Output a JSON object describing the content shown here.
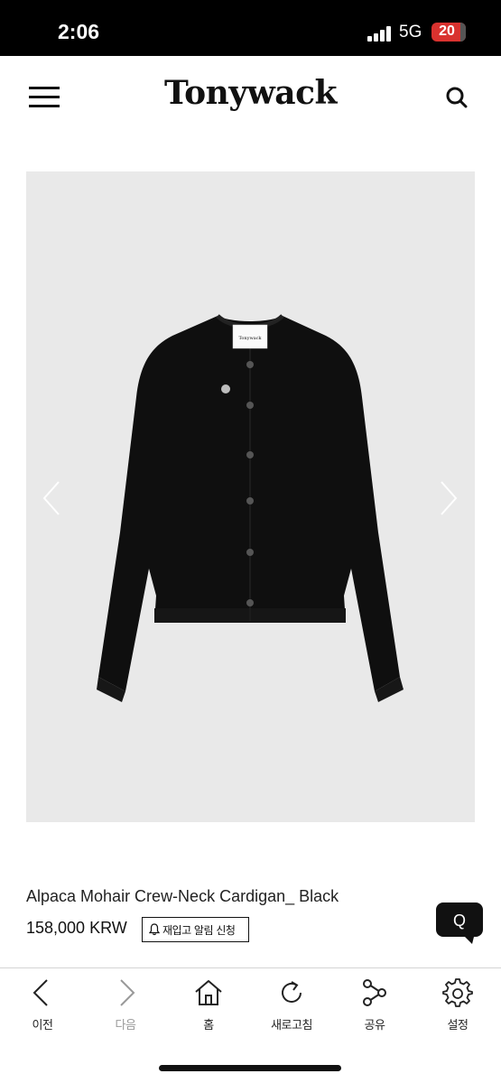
{
  "status_bar": {
    "time": "2:06",
    "network": "5G",
    "battery": "20"
  },
  "header": {
    "brand": "Tonywack",
    "menu_icon": "hamburger-menu-icon",
    "search_icon": "search-icon"
  },
  "gallery": {
    "prev_icon": "chevron-left-icon",
    "next_icon": "chevron-right-icon",
    "label_text": "Tonywack"
  },
  "product": {
    "name": "Alpaca Mohair Crew-Neck Cardigan_ Black",
    "price": "158,000 KRW",
    "restock_label": "재입고 알림 신청"
  },
  "qna": {
    "label": "Q"
  },
  "toolbar": {
    "items": [
      {
        "label": "이전",
        "icon": "back-arrow-icon",
        "enabled": true
      },
      {
        "label": "다음",
        "icon": "forward-arrow-icon",
        "enabled": false
      },
      {
        "label": "홈",
        "icon": "home-icon",
        "enabled": true
      },
      {
        "label": "새로고침",
        "icon": "refresh-icon",
        "enabled": true
      },
      {
        "label": "공유",
        "icon": "share-icon",
        "enabled": true
      },
      {
        "label": "설정",
        "icon": "gear-icon",
        "enabled": true
      }
    ]
  },
  "colors": {
    "battery": "#d9322f",
    "gallery_bg": "#e9e9e9",
    "garment": "#0f0f0f"
  }
}
